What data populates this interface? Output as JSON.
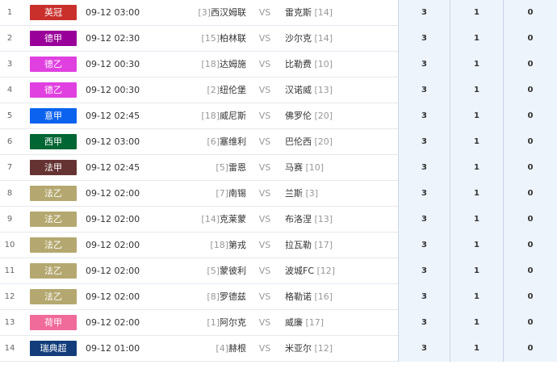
{
  "matches": [
    {
      "index": "1",
      "league": "英冠",
      "league_color": "#c9302c",
      "time": "09-12 03:00",
      "home_rank": "[3]",
      "home_team": "西汉姆联",
      "vs": "VS",
      "away_team": "雷克斯",
      "away_rank": "[14]",
      "odds": [
        "3",
        "1",
        "0"
      ]
    },
    {
      "index": "2",
      "league": "德甲",
      "league_color": "#990099",
      "time": "09-12 02:30",
      "home_rank": "[15]",
      "home_team": "柏林联",
      "vs": "VS",
      "away_team": "沙尔克",
      "away_rank": "[14]",
      "odds": [
        "3",
        "1",
        "0"
      ]
    },
    {
      "index": "3",
      "league": "德乙",
      "league_color": "#e040e0",
      "time": "09-12 00:30",
      "home_rank": "[18]",
      "home_team": "达姆施",
      "vs": "VS",
      "away_team": "比勒费",
      "away_rank": "[10]",
      "odds": [
        "3",
        "1",
        "0"
      ]
    },
    {
      "index": "4",
      "league": "德乙",
      "league_color": "#e040e0",
      "time": "09-12 00:30",
      "home_rank": "[2]",
      "home_team": "纽伦堡",
      "vs": "VS",
      "away_team": "汉诺威",
      "away_rank": "[13]",
      "odds": [
        "3",
        "1",
        "0"
      ]
    },
    {
      "index": "5",
      "league": "意甲",
      "league_color": "#0a62ee",
      "time": "09-12 02:45",
      "home_rank": "[18]",
      "home_team": "威尼斯",
      "vs": "VS",
      "away_team": "佛罗伦",
      "away_rank": "[20]",
      "odds": [
        "3",
        "1",
        "0"
      ]
    },
    {
      "index": "6",
      "league": "西甲",
      "league_color": "#006633",
      "time": "09-12 03:00",
      "home_rank": "[6]",
      "home_team": "塞维利",
      "vs": "VS",
      "away_team": "巴伦西",
      "away_rank": "[20]",
      "odds": [
        "3",
        "1",
        "0"
      ]
    },
    {
      "index": "7",
      "league": "法甲",
      "league_color": "#663333",
      "time": "09-12 02:45",
      "home_rank": "[5]",
      "home_team": "雷恩",
      "vs": "VS",
      "away_team": "马赛",
      "away_rank": "[10]",
      "odds": [
        "3",
        "1",
        "0"
      ]
    },
    {
      "index": "8",
      "league": "法乙",
      "league_color": "#b4a870",
      "time": "09-12 02:00",
      "home_rank": "[7]",
      "home_team": "南锡",
      "vs": "VS",
      "away_team": "兰斯",
      "away_rank": "[3]",
      "odds": [
        "3",
        "1",
        "0"
      ]
    },
    {
      "index": "9",
      "league": "法乙",
      "league_color": "#b4a870",
      "time": "09-12 02:00",
      "home_rank": "[14]",
      "home_team": "克莱蒙",
      "vs": "VS",
      "away_team": "布洛涅",
      "away_rank": "[13]",
      "odds": [
        "3",
        "1",
        "0"
      ]
    },
    {
      "index": "10",
      "league": "法乙",
      "league_color": "#b4a870",
      "time": "09-12 02:00",
      "home_rank": "[18]",
      "home_team": "第戎",
      "vs": "VS",
      "away_team": "拉瓦勒",
      "away_rank": "[17]",
      "odds": [
        "3",
        "1",
        "0"
      ]
    },
    {
      "index": "11",
      "league": "法乙",
      "league_color": "#b4a870",
      "time": "09-12 02:00",
      "home_rank": "[5]",
      "home_team": "蒙彼利",
      "vs": "VS",
      "away_team": "波城FC",
      "away_rank": "[12]",
      "odds": [
        "3",
        "1",
        "0"
      ]
    },
    {
      "index": "12",
      "league": "法乙",
      "league_color": "#b4a870",
      "time": "09-12 02:00",
      "home_rank": "[8]",
      "home_team": "罗德兹",
      "vs": "VS",
      "away_team": "格勒诺",
      "away_rank": "[16]",
      "odds": [
        "3",
        "1",
        "0"
      ]
    },
    {
      "index": "13",
      "league": "荷甲",
      "league_color": "#f06a9a",
      "time": "09-12 02:00",
      "home_rank": "[1]",
      "home_team": "阿尔克",
      "vs": "VS",
      "away_team": "威廉",
      "away_rank": "[17]",
      "odds": [
        "3",
        "1",
        "0"
      ]
    },
    {
      "index": "14",
      "league": "瑞典超",
      "league_color": "#123d7a",
      "time": "09-12 01:00",
      "home_rank": "[4]",
      "home_team": "赫根",
      "vs": "VS",
      "away_team": "米亚尔",
      "away_rank": "[12]",
      "odds": [
        "3",
        "1",
        "0"
      ]
    }
  ]
}
